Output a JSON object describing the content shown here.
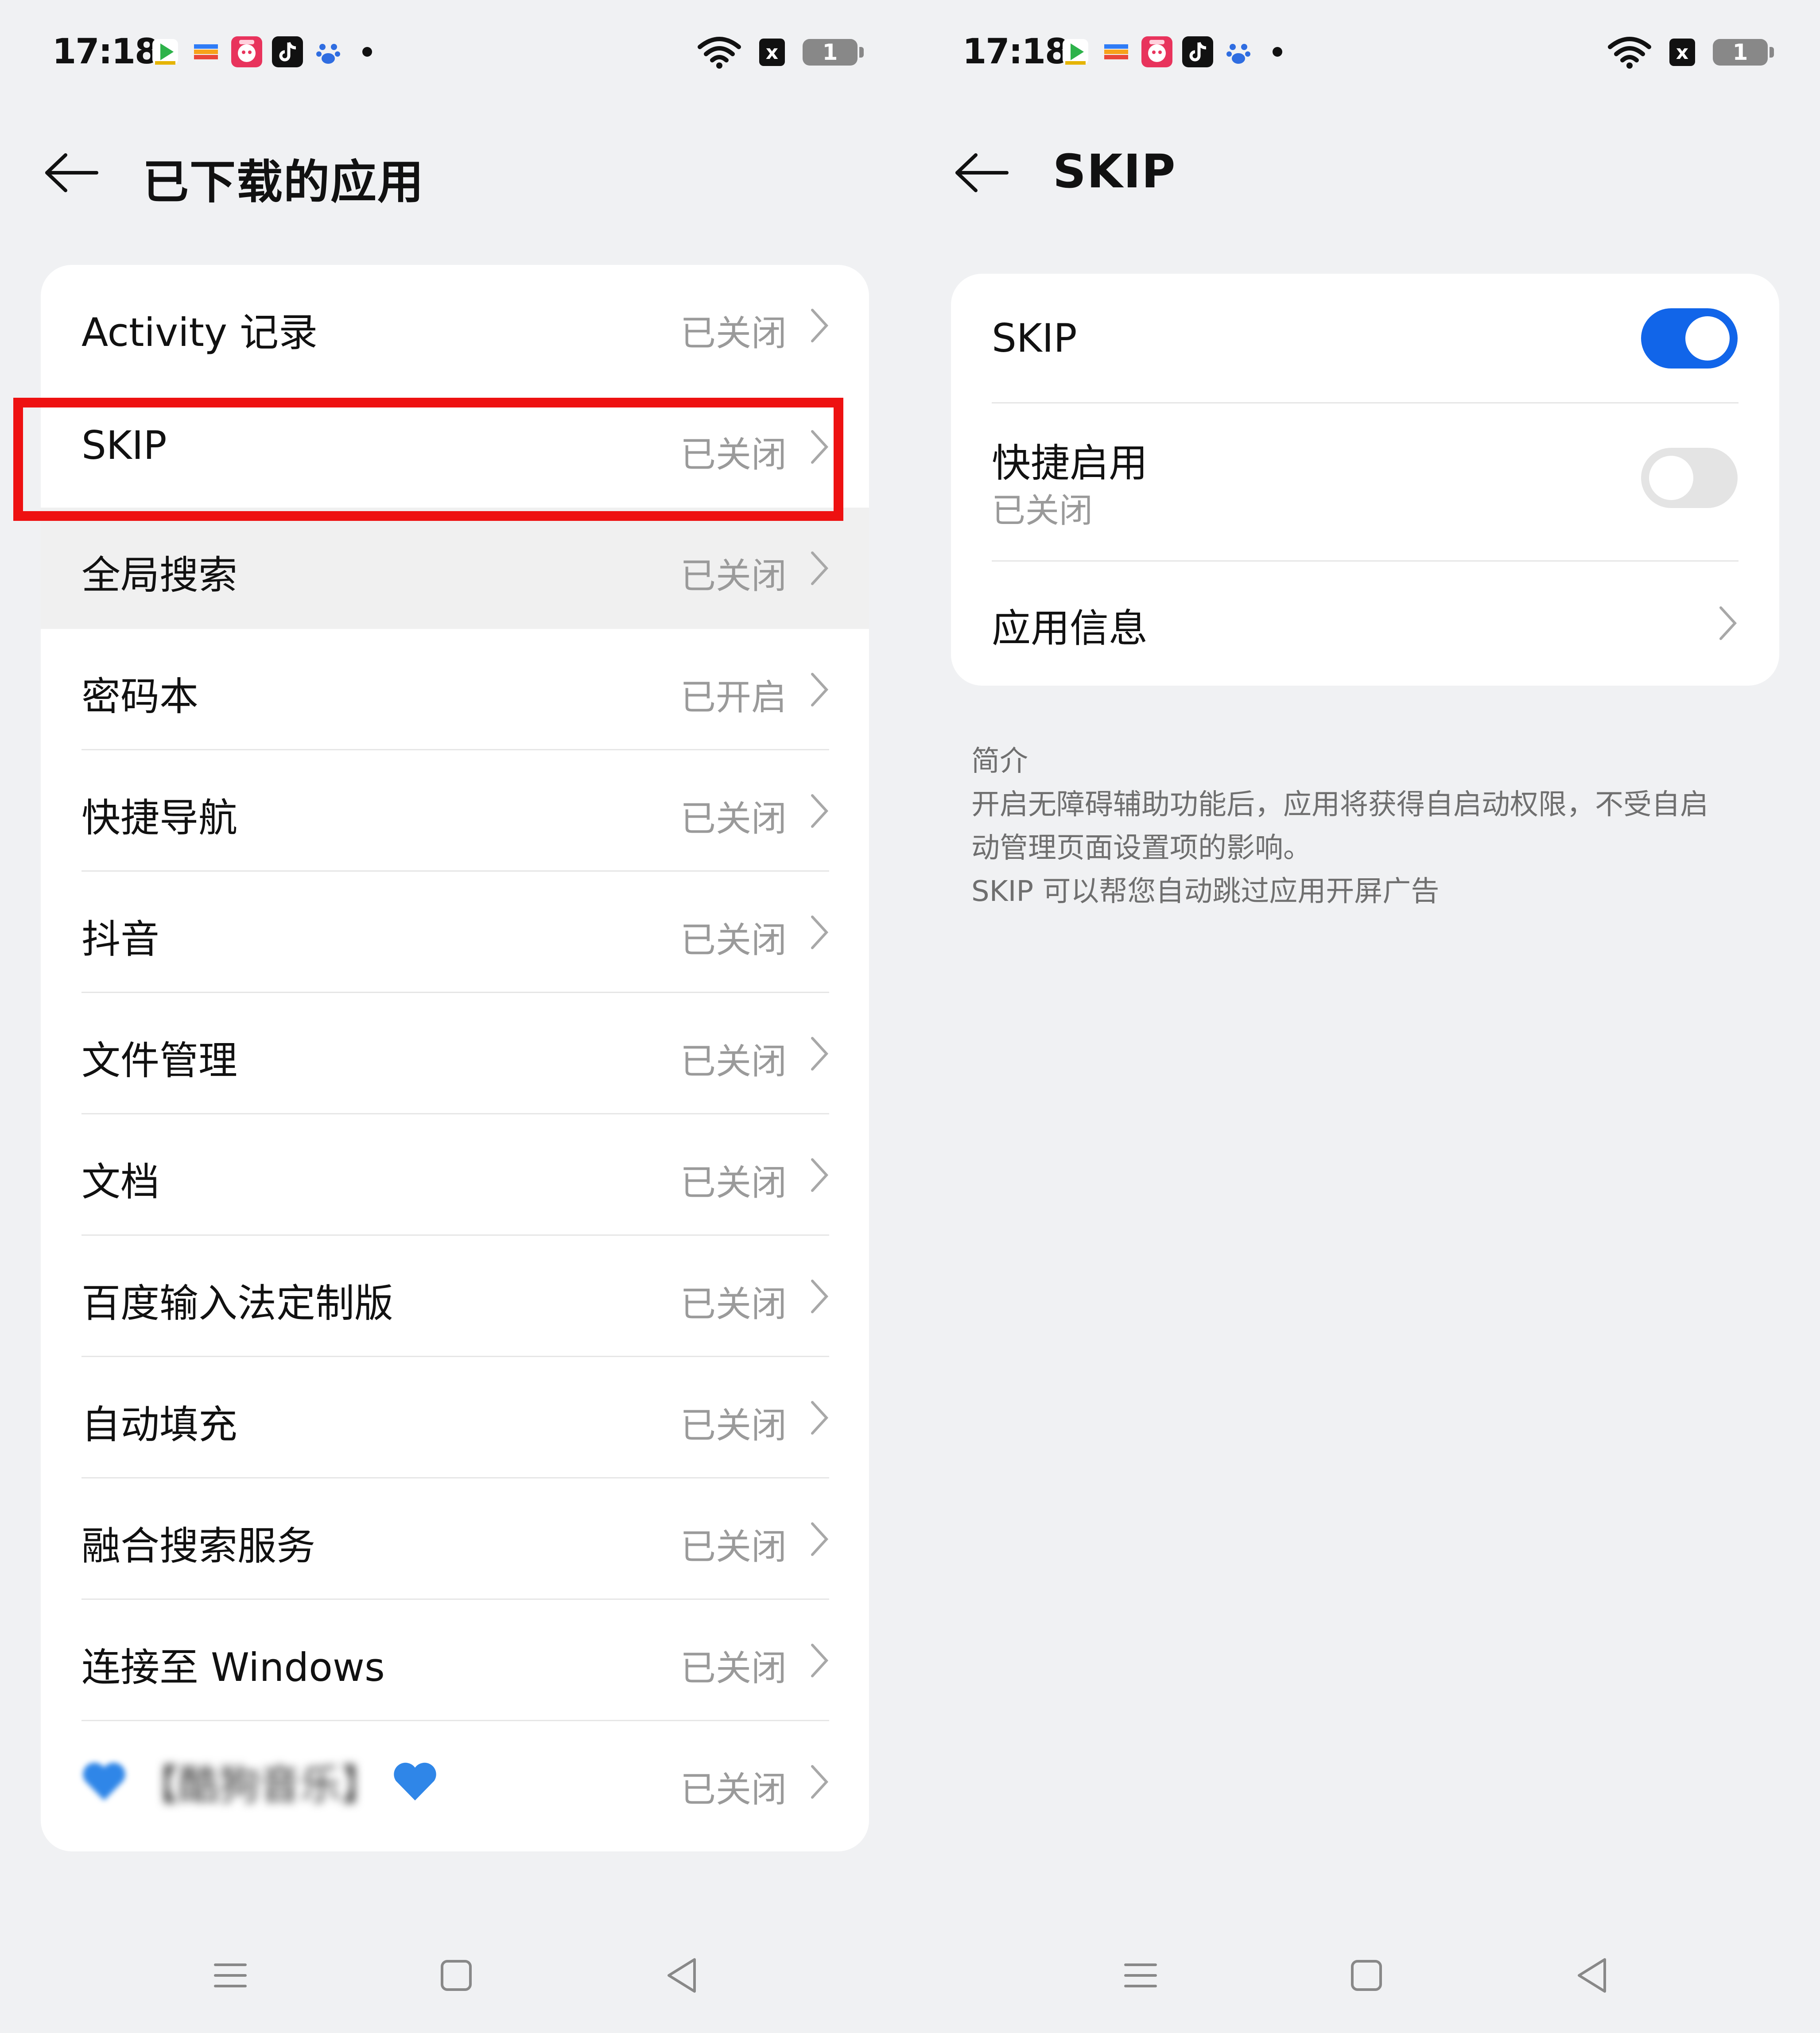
{
  "colors": {
    "accent_blue": "#1165e9",
    "highlight_red": "#ee1111",
    "page_bg": "#f0f1f3",
    "muted_text": "#9a9a9a"
  },
  "left_screen": {
    "status_bar": {
      "time": "17:18",
      "notification_icons": [
        "play-icon",
        "wallet-icon",
        "pinduoduo-icon",
        "tiktok-icon",
        "baidu-icon"
      ],
      "battery_level": "1",
      "nfc_label": "x"
    },
    "header": {
      "title": "已下载的应用"
    },
    "list": [
      {
        "label": "Activity 记录",
        "status": "已关闭"
      },
      {
        "label": "SKIP",
        "status": "已关闭"
      },
      {
        "label": "全局搜索",
        "status": "已关闭"
      },
      {
        "label": "密码本",
        "status": "已开启"
      },
      {
        "label": "快捷导航",
        "status": "已关闭"
      },
      {
        "label": "抖音",
        "status": "已关闭"
      },
      {
        "label": "文件管理",
        "status": "已关闭"
      },
      {
        "label": "文档",
        "status": "已关闭"
      },
      {
        "label": "百度输入法定制版",
        "status": "已关闭"
      },
      {
        "label": "自动填充",
        "status": "已关闭"
      },
      {
        "label": "融合搜索服务",
        "status": "已关闭"
      },
      {
        "label": "连接至 Windows",
        "status": "已关闭"
      },
      {
        "label": "【酷狗音乐】",
        "status": "已关闭"
      }
    ]
  },
  "right_screen": {
    "status_bar": {
      "time": "17:18",
      "battery_level": "1",
      "nfc_label": "x"
    },
    "header": {
      "title": "SKIP"
    },
    "settings": {
      "main_toggle_label": "SKIP",
      "main_toggle_on": true,
      "quick_enable_label": "快捷启用",
      "quick_enable_status": "已关闭",
      "quick_enable_on": false,
      "app_info_label": "应用信息"
    },
    "intro": {
      "heading": "简介",
      "line1": "开启无障碍辅助功能后，应用将获得自启动权限，不受自启",
      "line2": "动管理页面设置项的影响。",
      "line3": "SKIP 可以帮您自动跳过应用开屏广告"
    }
  }
}
